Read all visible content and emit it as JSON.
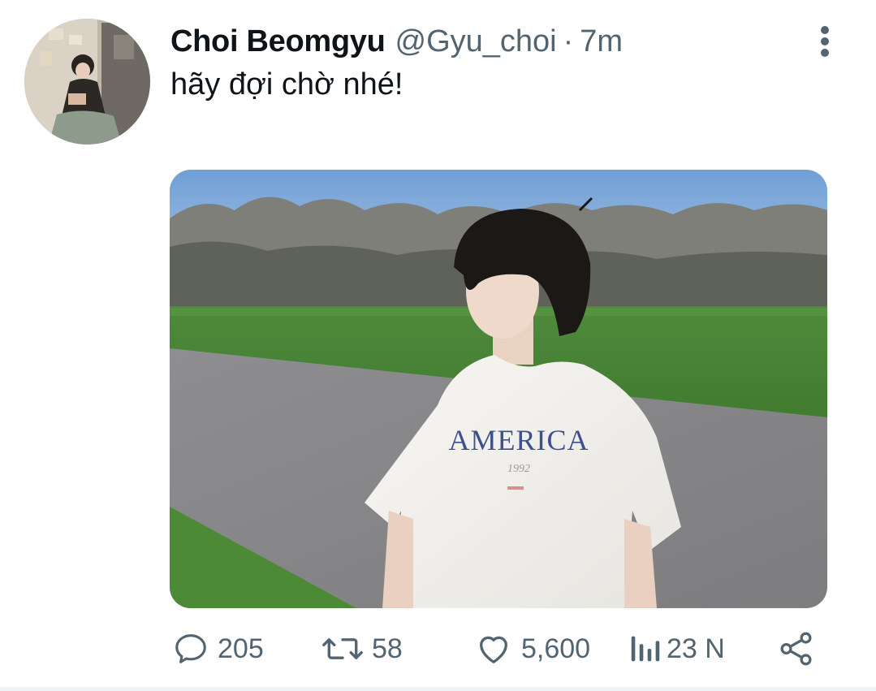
{
  "tweet": {
    "author": {
      "display_name": "Choi Beomgyu",
      "handle": "@Gyu_choi"
    },
    "separator": "·",
    "time": "7m",
    "text": "hãy đợi chờ nhé!",
    "media": {
      "shirt_text": "AMERICA",
      "shirt_year": "1992"
    },
    "stats": {
      "replies": "205",
      "retweets": "58",
      "likes": "5,600",
      "views": "23 N"
    }
  },
  "icons": {
    "more": "more-vertical-icon",
    "reply": "reply-icon",
    "retweet": "retweet-icon",
    "like": "heart-icon",
    "views": "views-icon",
    "share": "share-icon"
  },
  "colors": {
    "text_primary": "#0f1419",
    "text_secondary": "#536471",
    "border": "#eff3f4"
  }
}
